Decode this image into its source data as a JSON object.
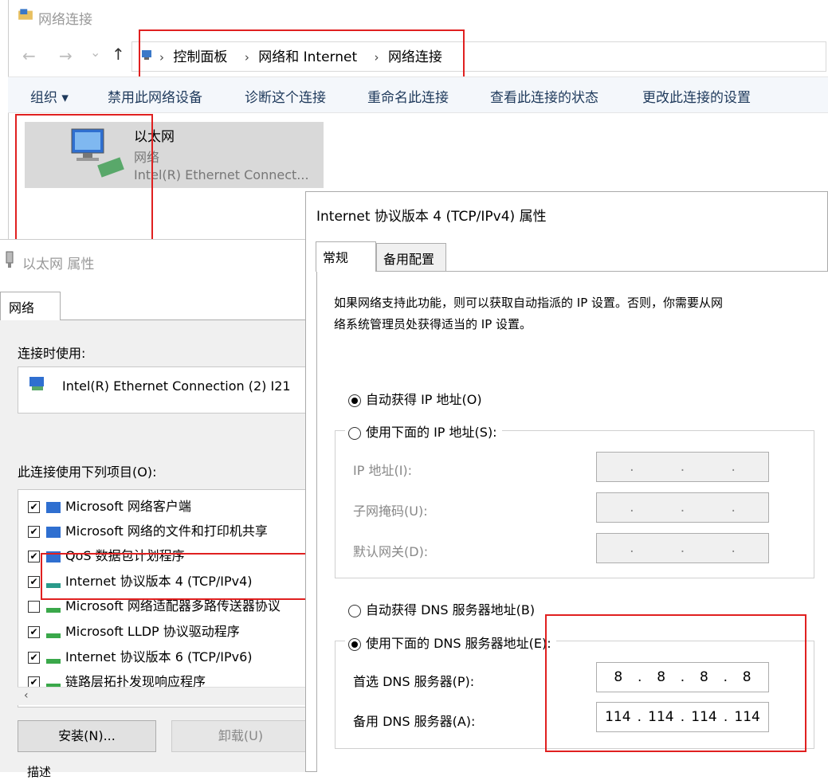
{
  "explorer": {
    "title": "网络连接",
    "nav": {
      "back": "←",
      "forward": "→",
      "recent": "⌄",
      "up": "↑"
    },
    "breadcrumb": [
      "控制面板",
      "网络和 Internet",
      "网络连接"
    ],
    "toolbar": [
      "组织 ▾",
      "禁用此网络设备",
      "诊断这个连接",
      "重命名此连接",
      "查看此连接的状态",
      "更改此连接的设置"
    ],
    "adapter": {
      "name": "以太网",
      "type": "网络",
      "device": "Intel(R) Ethernet Connect..."
    }
  },
  "eth_props": {
    "title": "以太网 属性",
    "tab": "网络",
    "connect_using_label": "连接时使用:",
    "connect_using_value": "Intel(R) Ethernet Connection (2) I21",
    "items_label": "此连接使用下列项目(O):",
    "items": [
      {
        "label": "Microsoft 网络客户端",
        "checked": true
      },
      {
        "label": "Microsoft 网络的文件和打印机共享",
        "checked": true
      },
      {
        "label": "QoS 数据包计划程序",
        "checked": true
      },
      {
        "label": "Internet 协议版本 4 (TCP/IPv4)",
        "checked": true
      },
      {
        "label": "Microsoft 网络适配器多路传送器协议",
        "checked": false
      },
      {
        "label": "Microsoft LLDP 协议驱动程序",
        "checked": true
      },
      {
        "label": "Internet 协议版本 6 (TCP/IPv6)",
        "checked": true
      },
      {
        "label": "链路层拓扑发现响应程序",
        "checked": true
      }
    ],
    "install_button": "安装(N)...",
    "uninstall_button": "卸载(U)",
    "description_label": "描述"
  },
  "ipv4": {
    "title": "Internet 协议版本 4 (TCP/IPv4) 属性",
    "tabs": [
      "常规",
      "备用配置"
    ],
    "description": "如果网络支持此功能，则可以获取自动指派的 IP 设置。否则，你需要从网络系统管理员处获得适当的 IP 设置。",
    "desc_line1": "如果网络支持此功能，则可以获取自动指派的 IP 设置。否则，你需要从网",
    "desc_line2": "络系统管理员处获得适当的 IP 设置。",
    "auto_ip": "自动获得 IP 地址(O)",
    "manual_ip": "使用下面的 IP 地址(S):",
    "ip_label": "IP 地址(I):",
    "mask_label": "子网掩码(U):",
    "gateway_label": "默认网关(D):",
    "auto_dns": "自动获得 DNS 服务器地址(B)",
    "manual_dns": "使用下面的 DNS 服务器地址(E):",
    "preferred_dns_label": "首选 DNS 服务器(P):",
    "alternate_dns_label": "备用 DNS 服务器(A):",
    "preferred_dns": [
      "8",
      "8",
      "8",
      "8"
    ],
    "alternate_dns": [
      "114",
      "114",
      "114",
      "114"
    ],
    "selected_ip_mode": "auto",
    "selected_dns_mode": "manual"
  },
  "colors": {
    "highlight_red": "#e02020",
    "toolbar_text": "#1e395b"
  }
}
